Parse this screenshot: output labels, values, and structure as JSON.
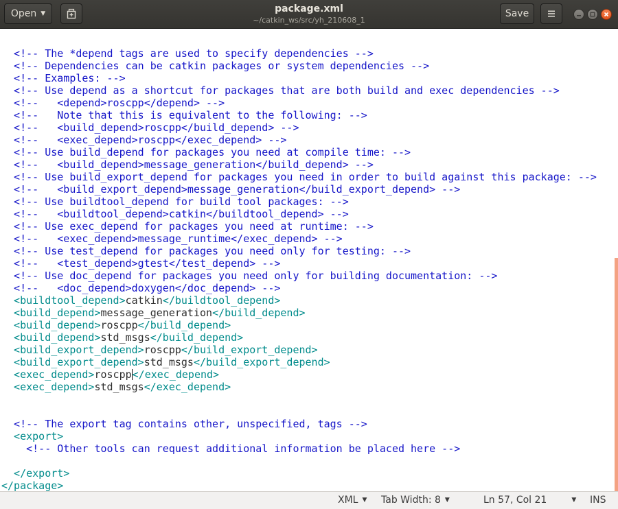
{
  "header": {
    "open_label": "Open",
    "title": "package.xml",
    "path": "~/catkin_ws/src/yh_210608_1",
    "save_label": "Save"
  },
  "editor": {
    "lines": [
      [
        [
          "c",
          "  <!-- The *depend tags are used to specify dependencies -->"
        ]
      ],
      [
        [
          "c",
          "  <!-- Dependencies can be catkin packages or system dependencies -->"
        ]
      ],
      [
        [
          "c",
          "  <!-- Examples: -->"
        ]
      ],
      [
        [
          "c",
          "  <!-- Use depend as a shortcut for packages that are both build and exec dependencies -->"
        ]
      ],
      [
        [
          "c",
          "  <!--   <depend>roscpp</depend> -->"
        ]
      ],
      [
        [
          "c",
          "  <!--   Note that this is equivalent to the following: -->"
        ]
      ],
      [
        [
          "c",
          "  <!--   <build_depend>roscpp</build_depend> -->"
        ]
      ],
      [
        [
          "c",
          "  <!--   <exec_depend>roscpp</exec_depend> -->"
        ]
      ],
      [
        [
          "c",
          "  <!-- Use build_depend for packages you need at compile time: -->"
        ]
      ],
      [
        [
          "c",
          "  <!--   <build_depend>message_generation</build_depend> -->"
        ]
      ],
      [
        [
          "c",
          "  <!-- Use build_export_depend for packages you need in order to build against this package: -->"
        ]
      ],
      [
        [
          "c",
          "  <!--   <build_export_depend>message_generation</build_export_depend> -->"
        ]
      ],
      [
        [
          "c",
          "  <!-- Use buildtool_depend for build tool packages: -->"
        ]
      ],
      [
        [
          "c",
          "  <!--   <buildtool_depend>catkin</buildtool_depend> -->"
        ]
      ],
      [
        [
          "c",
          "  <!-- Use exec_depend for packages you need at runtime: -->"
        ]
      ],
      [
        [
          "c",
          "  <!--   <exec_depend>message_runtime</exec_depend> -->"
        ]
      ],
      [
        [
          "c",
          "  <!-- Use test_depend for packages you need only for testing: -->"
        ]
      ],
      [
        [
          "c",
          "  <!--   <test_depend>gtest</test_depend> -->"
        ]
      ],
      [
        [
          "c",
          "  <!-- Use doc_depend for packages you need only for building documentation: -->"
        ]
      ],
      [
        [
          "c",
          "  <!--   <doc_depend>doxygen</doc_depend> -->"
        ]
      ],
      [
        [
          "g",
          "  <buildtool_depend>"
        ],
        [
          "t",
          "catkin"
        ],
        [
          "g",
          "</buildtool_depend>"
        ]
      ],
      [
        [
          "g",
          "  <build_depend>"
        ],
        [
          "t",
          "message_generation"
        ],
        [
          "g",
          "</build_depend>"
        ]
      ],
      [
        [
          "g",
          "  <build_depend>"
        ],
        [
          "t",
          "roscpp"
        ],
        [
          "g",
          "</build_depend>"
        ]
      ],
      [
        [
          "g",
          "  <build_depend>"
        ],
        [
          "t",
          "std_msgs"
        ],
        [
          "g",
          "</build_depend>"
        ]
      ],
      [
        [
          "g",
          "  <build_export_depend>"
        ],
        [
          "t",
          "roscpp"
        ],
        [
          "g",
          "</build_export_depend>"
        ]
      ],
      [
        [
          "g",
          "  <build_export_depend>"
        ],
        [
          "t",
          "std_msgs"
        ],
        [
          "g",
          "</build_export_depend>"
        ]
      ],
      [
        [
          "g",
          "  <exec_depend>"
        ],
        [
          "t",
          "roscpp"
        ],
        [
          "k",
          ""
        ],
        [
          "g",
          "</exec_depend>"
        ]
      ],
      [
        [
          "g",
          "  <exec_depend>"
        ],
        [
          "t",
          "std_msgs"
        ],
        [
          "g",
          "</exec_depend>"
        ]
      ],
      [],
      [],
      [
        [
          "c",
          "  <!-- The export tag contains other, unspecified, tags -->"
        ]
      ],
      [
        [
          "g",
          "  <export>"
        ]
      ],
      [
        [
          "c",
          "    <!-- Other tools can request additional information be placed here -->"
        ]
      ],
      [],
      [
        [
          "g",
          "  </export>"
        ]
      ],
      [
        [
          "g",
          "</package>"
        ]
      ]
    ]
  },
  "status": {
    "language": "XML",
    "tab_width": "Tab Width: 8",
    "position": "Ln 57, Col 21",
    "mode": "INS"
  },
  "colors": {
    "comment": "#1515c8",
    "tag": "#008b8b",
    "text": "#2e2e2e",
    "close_button": "#e95420"
  },
  "icons": {
    "open_dropdown": "triangle-down-icon",
    "new_document": "new-document-icon",
    "menu": "hamburger-menu-icon",
    "minimize": "minimize-icon",
    "maximize": "maximize-icon",
    "close": "close-icon"
  }
}
